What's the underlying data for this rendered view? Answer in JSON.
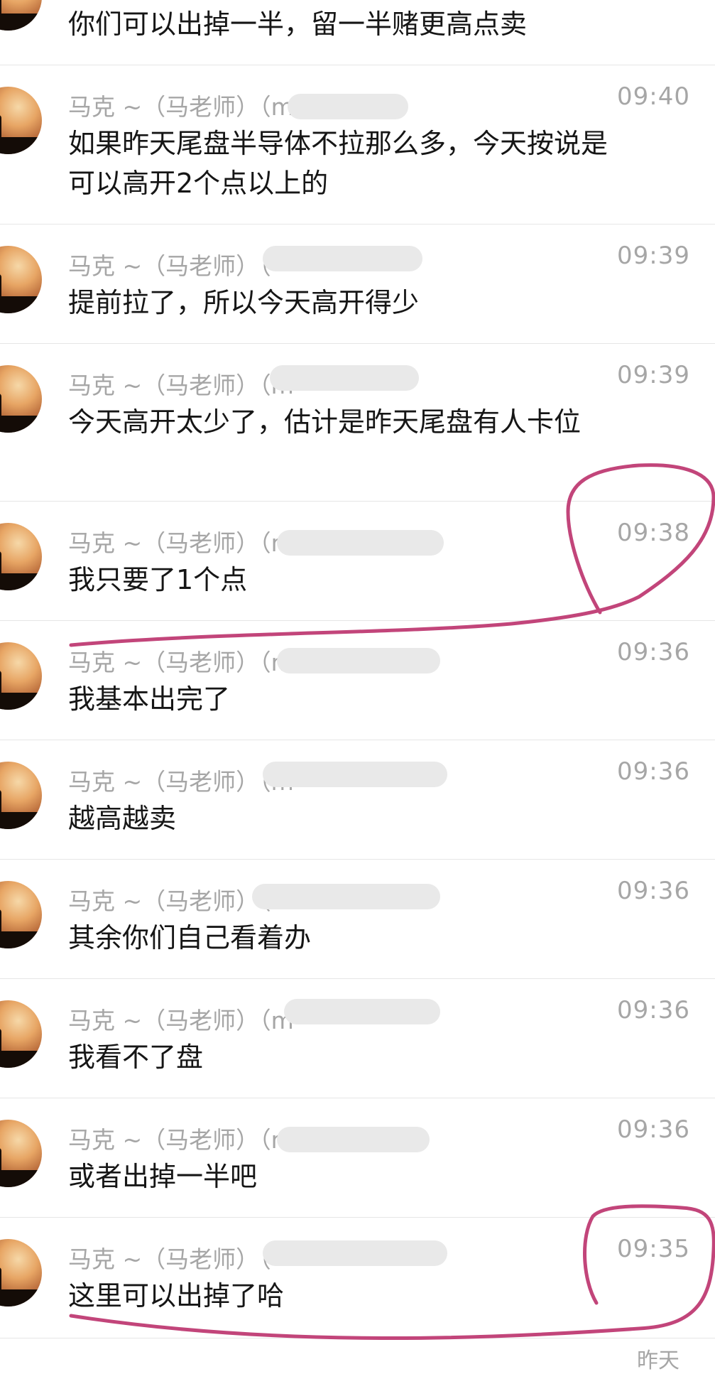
{
  "first_message": {
    "text": "你们可以出掉一半，留一半赌更高点卖"
  },
  "sender_prefix": "马克 ~（马老师）（",
  "messages": [
    {
      "sender": "马克 ~（马老师）（m",
      "time": "09:40",
      "text": "如果昨天尾盘半导体不拉那么多，今天按说是可以高开2个点以上的"
    },
    {
      "sender": "马克 ~（马老师）（",
      "time": "09:39",
      "text": "提前拉了，所以今天高开得少"
    },
    {
      "sender": "马克 ~（马老师）（m",
      "time": "09:39",
      "text": "今天高开太少了，估计是昨天尾盘有人卡位"
    },
    {
      "sender": "马克 ~（马老师）（m",
      "time": "09:38",
      "text": "我只要了1个点"
    },
    {
      "sender": "马克 ~（马老师）（m",
      "time": "09:36",
      "text": "我基本出完了"
    },
    {
      "sender": "马克 ~（马老师）（m",
      "time": "09:36",
      "text": "越高越卖"
    },
    {
      "sender": "马克 ~（马老师）（m",
      "time": "09:36",
      "text": "其余你们自己看着办"
    },
    {
      "sender": "马克 ~（马老师）（m",
      "time": "09:36",
      "text": "我看不了盘"
    },
    {
      "sender": "马克 ~（马老师）（m",
      "time": "09:36",
      "text": "或者出掉一半吧"
    },
    {
      "sender": "马克 ~（马老师）（",
      "time": "09:35",
      "text": "这里可以出掉了哈"
    }
  ],
  "annotation_color": "#c2457a",
  "bottom_partial_time": "昨天"
}
